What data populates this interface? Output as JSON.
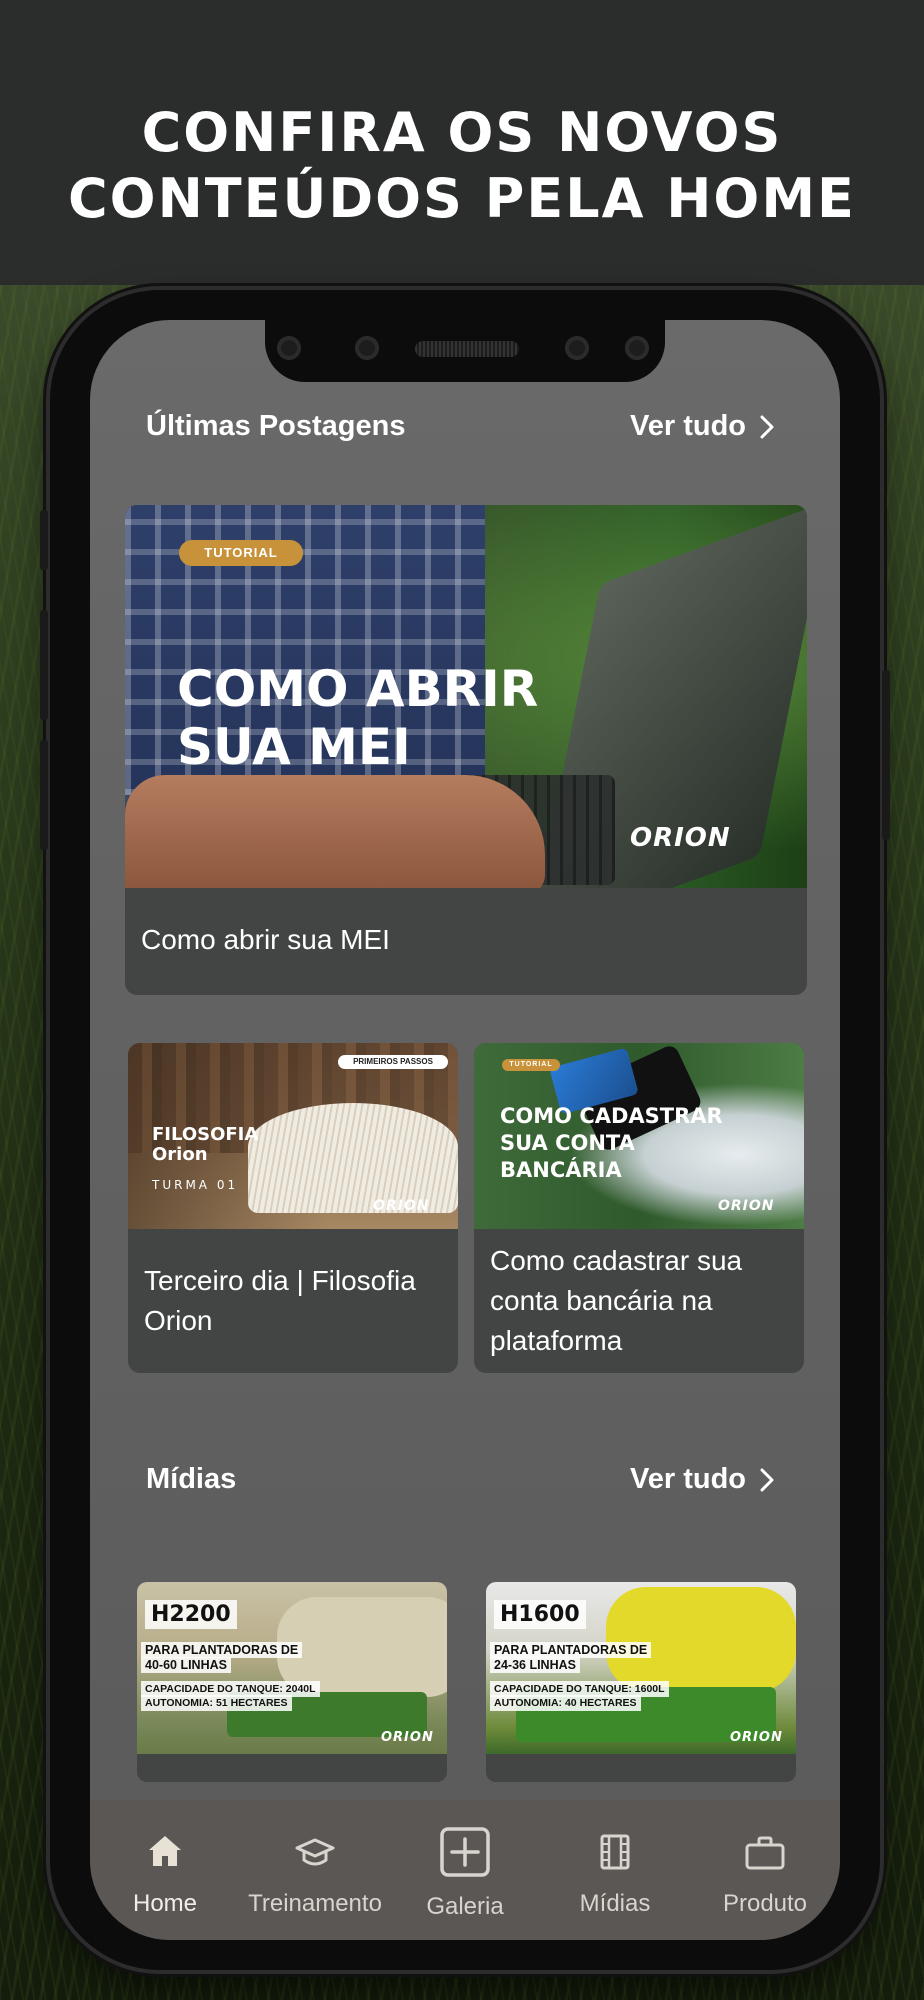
{
  "headline": {
    "line1": "CONFIRA OS NOVOS",
    "line2": "CONTEÚDOS PELA HOME"
  },
  "posts": {
    "title": "Últimas Postagens",
    "see_all": "Ver tudo",
    "featured": {
      "tag": "TUTORIAL",
      "overlay_line1": "COMO ABRIR",
      "overlay_line2": "SUA MEI",
      "logo": "ORION",
      "caption": "Como abrir sua MEI"
    },
    "cards": [
      {
        "tag": "PRIMEIROS PASSOS",
        "overlay_line1": "FILOSOFIA",
        "overlay_line2": "Orion",
        "overlay_line3": "TURMA  01",
        "logo": "ORION",
        "caption_line1": "Terceiro dia | Filosofia",
        "caption_line2": "Orion"
      },
      {
        "tag": "TUTORIAL",
        "overlay_line1": "COMO CADASTRAR",
        "overlay_line2": "SUA CONTA",
        "overlay_line3": "BANCÁRIA",
        "logo": "ORION",
        "caption_line1": "Como cadastrar sua",
        "caption_line2": "conta bancária na",
        "caption_line3": "plataforma"
      }
    ]
  },
  "media": {
    "title": "Mídias",
    "see_all": "Ver tudo",
    "items": [
      {
        "model": "H2200",
        "sub1": "PARA PLANTADORAS DE",
        "sub2": "40-60 LINHAS",
        "spec1": "CAPACIDADE DO TANQUE: 2040L",
        "spec2": "AUTONOMIA: 51 HECTARES",
        "logo": "ORION"
      },
      {
        "model": "H1600",
        "sub1": "PARA PLANTADORAS DE",
        "sub2": "24-36 LINHAS",
        "spec1": "CAPACIDADE DO TANQUE: 1600L",
        "spec2": "AUTONOMIA: 40 HECTARES",
        "logo": "ORION"
      }
    ]
  },
  "tabbar": [
    {
      "label": "Home",
      "icon": "home-icon",
      "active": true
    },
    {
      "label": "Treinamento",
      "icon": "graduation-cap-icon",
      "active": false
    },
    {
      "label": "Galeria",
      "icon": "plus-square-icon",
      "active": false
    },
    {
      "label": "Mídias",
      "icon": "film-icon",
      "active": false
    },
    {
      "label": "Produto",
      "icon": "briefcase-icon",
      "active": false
    }
  ],
  "colors": {
    "tag": "#c8923a",
    "tabbar_bg": "#5a5754",
    "card_bg": "#434444",
    "screen_bg": "#626262"
  }
}
